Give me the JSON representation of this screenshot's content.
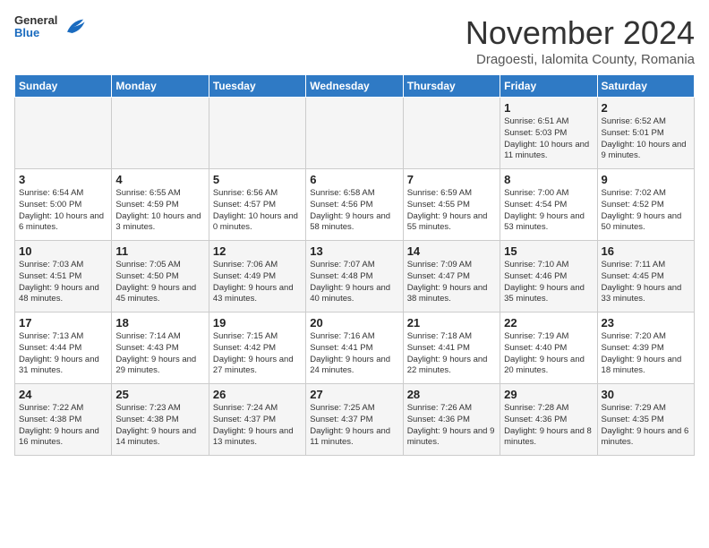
{
  "header": {
    "logo_general": "General",
    "logo_blue": "Blue",
    "month_title": "November 2024",
    "location": "Dragoesti, Ialomita County, Romania"
  },
  "weekdays": [
    "Sunday",
    "Monday",
    "Tuesday",
    "Wednesday",
    "Thursday",
    "Friday",
    "Saturday"
  ],
  "weeks": [
    [
      {
        "day": "",
        "info": ""
      },
      {
        "day": "",
        "info": ""
      },
      {
        "day": "",
        "info": ""
      },
      {
        "day": "",
        "info": ""
      },
      {
        "day": "",
        "info": ""
      },
      {
        "day": "1",
        "info": "Sunrise: 6:51 AM\nSunset: 5:03 PM\nDaylight: 10 hours and 11 minutes."
      },
      {
        "day": "2",
        "info": "Sunrise: 6:52 AM\nSunset: 5:01 PM\nDaylight: 10 hours and 9 minutes."
      }
    ],
    [
      {
        "day": "3",
        "info": "Sunrise: 6:54 AM\nSunset: 5:00 PM\nDaylight: 10 hours and 6 minutes."
      },
      {
        "day": "4",
        "info": "Sunrise: 6:55 AM\nSunset: 4:59 PM\nDaylight: 10 hours and 3 minutes."
      },
      {
        "day": "5",
        "info": "Sunrise: 6:56 AM\nSunset: 4:57 PM\nDaylight: 10 hours and 0 minutes."
      },
      {
        "day": "6",
        "info": "Sunrise: 6:58 AM\nSunset: 4:56 PM\nDaylight: 9 hours and 58 minutes."
      },
      {
        "day": "7",
        "info": "Sunrise: 6:59 AM\nSunset: 4:55 PM\nDaylight: 9 hours and 55 minutes."
      },
      {
        "day": "8",
        "info": "Sunrise: 7:00 AM\nSunset: 4:54 PM\nDaylight: 9 hours and 53 minutes."
      },
      {
        "day": "9",
        "info": "Sunrise: 7:02 AM\nSunset: 4:52 PM\nDaylight: 9 hours and 50 minutes."
      }
    ],
    [
      {
        "day": "10",
        "info": "Sunrise: 7:03 AM\nSunset: 4:51 PM\nDaylight: 9 hours and 48 minutes."
      },
      {
        "day": "11",
        "info": "Sunrise: 7:05 AM\nSunset: 4:50 PM\nDaylight: 9 hours and 45 minutes."
      },
      {
        "day": "12",
        "info": "Sunrise: 7:06 AM\nSunset: 4:49 PM\nDaylight: 9 hours and 43 minutes."
      },
      {
        "day": "13",
        "info": "Sunrise: 7:07 AM\nSunset: 4:48 PM\nDaylight: 9 hours and 40 minutes."
      },
      {
        "day": "14",
        "info": "Sunrise: 7:09 AM\nSunset: 4:47 PM\nDaylight: 9 hours and 38 minutes."
      },
      {
        "day": "15",
        "info": "Sunrise: 7:10 AM\nSunset: 4:46 PM\nDaylight: 9 hours and 35 minutes."
      },
      {
        "day": "16",
        "info": "Sunrise: 7:11 AM\nSunset: 4:45 PM\nDaylight: 9 hours and 33 minutes."
      }
    ],
    [
      {
        "day": "17",
        "info": "Sunrise: 7:13 AM\nSunset: 4:44 PM\nDaylight: 9 hours and 31 minutes."
      },
      {
        "day": "18",
        "info": "Sunrise: 7:14 AM\nSunset: 4:43 PM\nDaylight: 9 hours and 29 minutes."
      },
      {
        "day": "19",
        "info": "Sunrise: 7:15 AM\nSunset: 4:42 PM\nDaylight: 9 hours and 27 minutes."
      },
      {
        "day": "20",
        "info": "Sunrise: 7:16 AM\nSunset: 4:41 PM\nDaylight: 9 hours and 24 minutes."
      },
      {
        "day": "21",
        "info": "Sunrise: 7:18 AM\nSunset: 4:41 PM\nDaylight: 9 hours and 22 minutes."
      },
      {
        "day": "22",
        "info": "Sunrise: 7:19 AM\nSunset: 4:40 PM\nDaylight: 9 hours and 20 minutes."
      },
      {
        "day": "23",
        "info": "Sunrise: 7:20 AM\nSunset: 4:39 PM\nDaylight: 9 hours and 18 minutes."
      }
    ],
    [
      {
        "day": "24",
        "info": "Sunrise: 7:22 AM\nSunset: 4:38 PM\nDaylight: 9 hours and 16 minutes."
      },
      {
        "day": "25",
        "info": "Sunrise: 7:23 AM\nSunset: 4:38 PM\nDaylight: 9 hours and 14 minutes."
      },
      {
        "day": "26",
        "info": "Sunrise: 7:24 AM\nSunset: 4:37 PM\nDaylight: 9 hours and 13 minutes."
      },
      {
        "day": "27",
        "info": "Sunrise: 7:25 AM\nSunset: 4:37 PM\nDaylight: 9 hours and 11 minutes."
      },
      {
        "day": "28",
        "info": "Sunrise: 7:26 AM\nSunset: 4:36 PM\nDaylight: 9 hours and 9 minutes."
      },
      {
        "day": "29",
        "info": "Sunrise: 7:28 AM\nSunset: 4:36 PM\nDaylight: 9 hours and 8 minutes."
      },
      {
        "day": "30",
        "info": "Sunrise: 7:29 AM\nSunset: 4:35 PM\nDaylight: 9 hours and 6 minutes."
      }
    ]
  ]
}
